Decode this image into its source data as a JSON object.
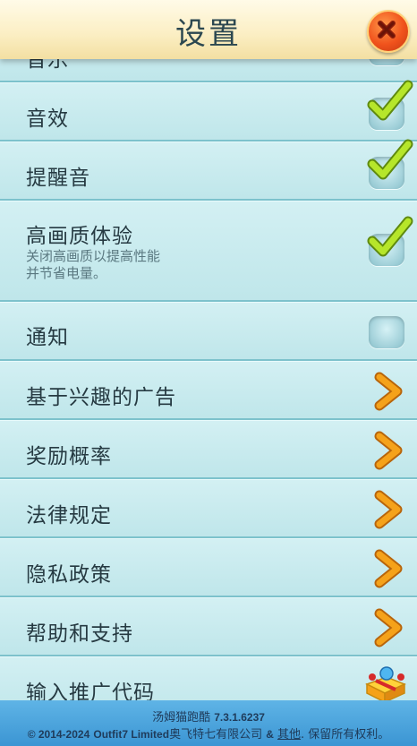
{
  "header": {
    "title": "设置"
  },
  "rows": [
    {
      "label": "音乐",
      "type": "checkbox",
      "checked": true
    },
    {
      "label": "音效",
      "type": "checkbox",
      "checked": true
    },
    {
      "label": "提醒音",
      "type": "checkbox",
      "checked": true
    },
    {
      "label": "高画质体验",
      "sub": "关闭高画质以提高性能\n并节省电量。",
      "type": "checkbox",
      "checked": true
    },
    {
      "label": "通知",
      "type": "checkbox",
      "checked": false
    },
    {
      "label": "基于兴趣的广告",
      "type": "chevron"
    },
    {
      "label": "奖励概率",
      "type": "chevron"
    },
    {
      "label": "法律规定",
      "type": "chevron"
    },
    {
      "label": "隐私政策",
      "type": "chevron"
    },
    {
      "label": "帮助和支持",
      "type": "chevron"
    },
    {
      "label": "输入推广代码",
      "type": "promo"
    }
  ],
  "footer": {
    "app_name": "汤姆猫跑酷",
    "version": "7.3.1.6237",
    "copyright_years": "© 2014-2024",
    "company_en": "Outfit7 Limited",
    "company_cn": "奥飞特七有限公司",
    "amp": "&",
    "others_link": "其他",
    "rights": ". 保留所有权利。"
  },
  "colors": {
    "check": "#b6e62a",
    "chevron": "#f5a21a",
    "close": "#f0521c"
  }
}
